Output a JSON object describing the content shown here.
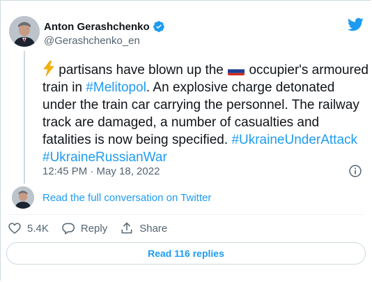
{
  "author": {
    "name": "Anton Gerashchenko",
    "handle": "@Gerashchenko_en",
    "verified": true
  },
  "tweet": {
    "lead_icon": "lightning-bolt-emoji",
    "flag_icon": "russia-flag-emoji",
    "text_part1": " partisans have blown up the ",
    "text_part2": " occupier's armoured train in ",
    "hashtag_city": "#Melitopol",
    "text_part3": ". An explosive charge detonated under the train car carrying the personnel. The railway track are damaged, a number of casualties and fatalities is now being specified. ",
    "hashtag_1": "#UkraineUnderAttack",
    "hashtag_2": "#UkraineRussianWar",
    "timestamp": "12:45 PM · May 18, 2022"
  },
  "conversation": {
    "link_text": "Read the full conversation on Twitter"
  },
  "actions": {
    "like_count": "5.4K",
    "reply_label": "Reply",
    "share_label": "Share"
  },
  "read_replies_label": "Read 116 replies",
  "colors": {
    "accent": "#1d9bf0",
    "text": "#0f1419",
    "muted": "#536471",
    "border": "#cfd9de"
  }
}
